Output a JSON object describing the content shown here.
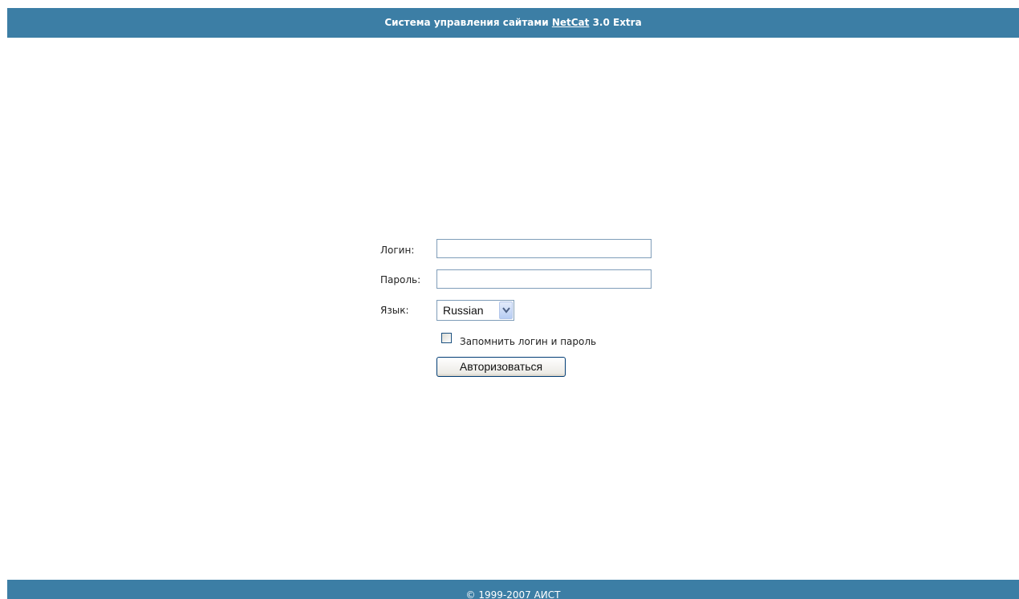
{
  "header": {
    "title_prefix": "Система управления сайтами",
    "brand_link": "NetCat",
    "title_suffix": "3.0 Extra"
  },
  "login_form": {
    "login_label": "Логин:",
    "login_value": "",
    "password_label": "Пароль:",
    "password_value": "",
    "language_label": "Язык:",
    "language_selected": "Russian",
    "remember_label": "Запомнить логин и пароль",
    "remember_checked": false,
    "submit_label": "Авторизоваться"
  },
  "footer": {
    "copyright": "© 1999-2007 АИСТ"
  },
  "colors": {
    "bar": "#3c7ea5"
  }
}
